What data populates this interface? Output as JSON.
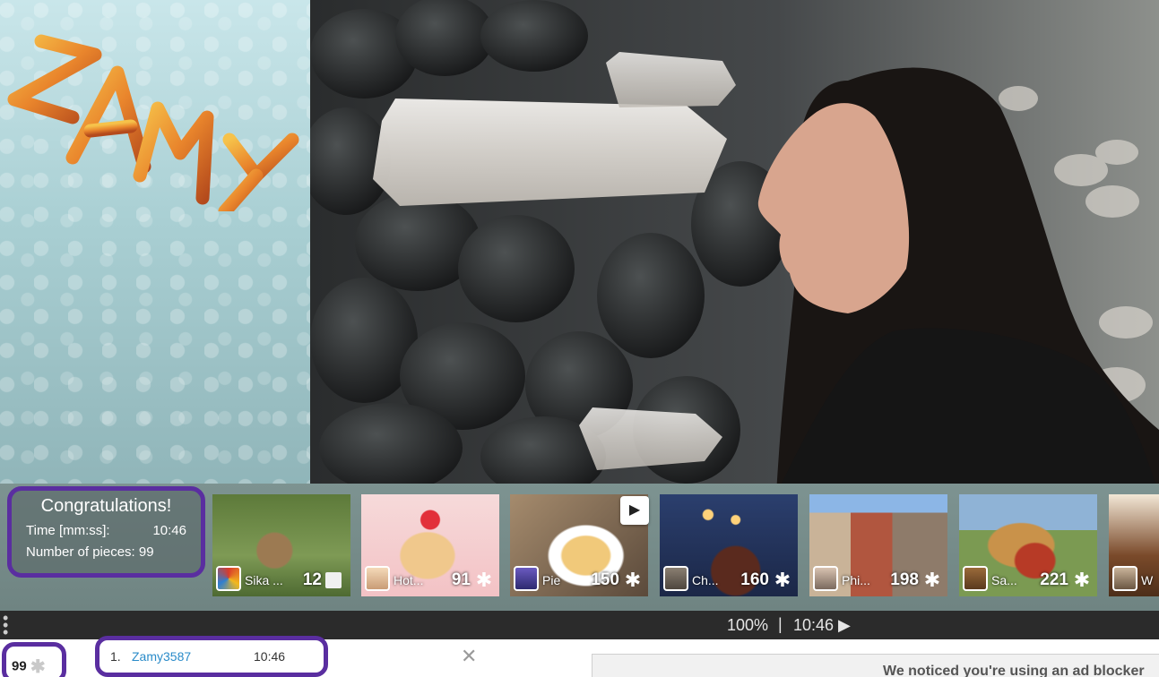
{
  "logo": {
    "text": "ZAMY"
  },
  "congrats": {
    "title": "Congratulations!",
    "time_label": "Time [mm:ss]:",
    "time_value": "10:46",
    "pieces_label": "Number of pieces: 99"
  },
  "thumbnails": [
    {
      "author": "Sika ...",
      "count": "12",
      "icon": "square-icon"
    },
    {
      "author": "Hot...",
      "count": "91",
      "icon": "puzzle-icon"
    },
    {
      "author": "Pie",
      "count": "150",
      "icon": "puzzle-icon"
    },
    {
      "author": "Ch...",
      "count": "160",
      "icon": "puzzle-icon"
    },
    {
      "author": "Phi...",
      "count": "198",
      "icon": "puzzle-icon"
    },
    {
      "author": "Sa...",
      "count": "221",
      "icon": "puzzle-icon"
    },
    {
      "author": "W",
      "count": "",
      "icon": ""
    }
  ],
  "statusbar": {
    "zoom": "100%",
    "separator": "|",
    "time": "10:46 ▶"
  },
  "piece_badge": {
    "count": "99"
  },
  "scores": [
    {
      "rank": "1.",
      "user": "Zamy3587",
      "time": "10:46"
    }
  ],
  "adblock": {
    "text": "We noticed you're using an ad blocker"
  },
  "colors": {
    "highlight_border": "#5a2ea0",
    "link": "#2a8bc9",
    "statusbar_bg": "#2b2b2b"
  }
}
